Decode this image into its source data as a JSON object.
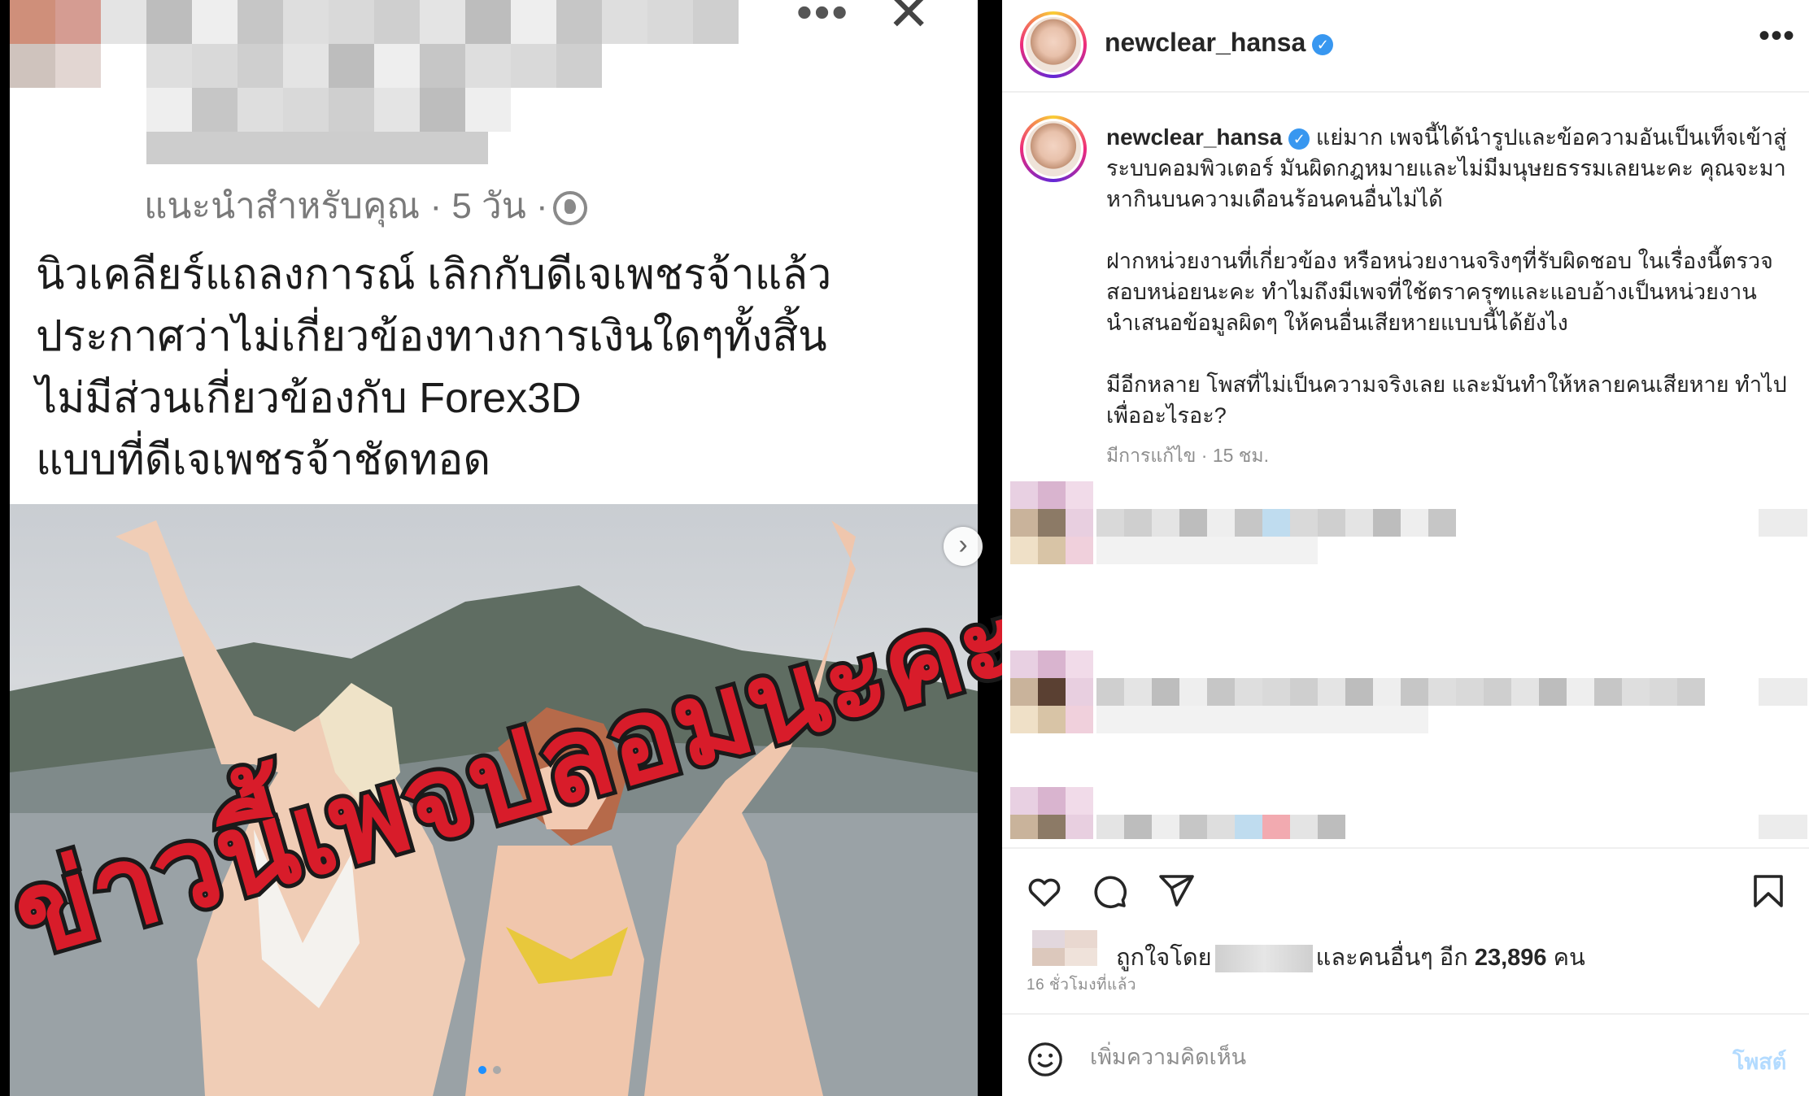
{
  "screenshot_post": {
    "meta": "แนะนำสำหรับคุณ · 5 วัน ·",
    "headline_lines": [
      "นิวเคลียร์แถลงการณ์ เลิกกับดีเจเพชรจ้าแล้ว",
      "ประกาศว่าไม่เกี่ยวข้องทางการเงินใดๆทั้งสิ้น",
      "ไม่มีส่วนเกี่ยวข้องกับ Forex3D",
      "แบบที่ดีเจเพชรจ้าชัดทอด"
    ],
    "overlay_text": "ข่าวนี้เพจปลอมนะคะ",
    "dots_label": "•••",
    "close_label": "✕"
  },
  "carousel": {
    "next_label": "›"
  },
  "header": {
    "username": "newclear_hansa",
    "verified_mark": "✓",
    "more_label": "•••"
  },
  "caption": {
    "username": "newclear_hansa",
    "paragraphs": [
      "แย่มาก เพจนี้ได้นำรูปและข้อความอันเป็นเท็จเข้าสู่ระบบคอมพิวเตอร์ มันผิดกฎหมายและไม่มีมนุษยธรรมเลยนะคะ คุณจะมาหากินบนความเดือนร้อนคนอื่นไม่ได้",
      "ฝากหน่วยงานที่เกี่ยวข้อง หรือหน่วยงานจริงๆที่รับผิดชอบ ในเรื่องนี้ตรวจสอบหน่อยนะคะ ทำไมถึงมีเพจที่ใช้ตราครุฑและแอบอ้างเป็นหน่วยงาน นำเสนอข้อมูลผิดๆ ให้คนอื่นเสียหายแบบนี้ได้ยังไง",
      "มีอีกหลาย โพสที่ไม่เป็นความจริงเลย และมันทำให้หลายคนเสียหาย ทำไปเพื่ออะไรอะ?"
    ],
    "meta": "มีการแก้ไข · 15 ชม."
  },
  "likes": {
    "prefix": "ถูกใจโดย",
    "middle": "และคนอื่นๆ อีก",
    "count": "23,896",
    "suffix": "คน"
  },
  "timestamp": "16 ชั่วโมงที่แล้ว",
  "comment": {
    "placeholder": "เพิ่มความคิดเห็น",
    "post_label": "โพสต์"
  },
  "colors": {
    "verified": "#3897f0",
    "overlay_red": "#d81c2a",
    "post_disabled": "#b3dbff"
  }
}
